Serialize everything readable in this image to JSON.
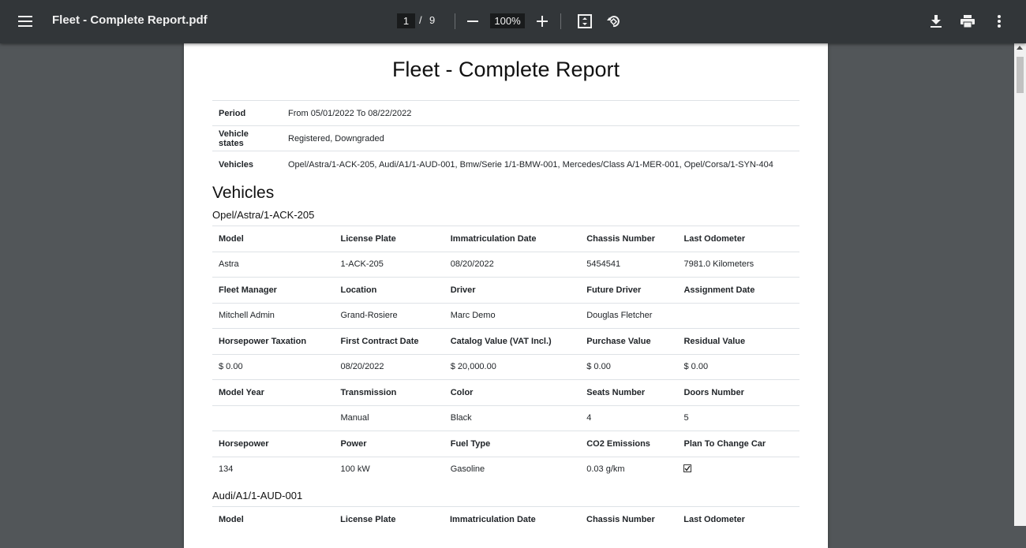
{
  "toolbar": {
    "title": "Fleet - Complete Report.pdf",
    "page_current": "1",
    "page_sep": "/",
    "page_total": "9",
    "zoom": "100%"
  },
  "report": {
    "title": "Fleet - Complete Report",
    "info": [
      {
        "key": "Period",
        "value": "From 05/01/2022 To 08/22/2022"
      },
      {
        "key": "Vehicle states",
        "value": "Registered, Downgraded"
      },
      {
        "key": "Vehicles",
        "value": "Opel/Astra/1-ACK-205, Audi/A1/1-AUD-001, Bmw/Serie 1/1-BMW-001, Mercedes/Class A/1-MER-001, Opel/Corsa/1-SYN-404"
      }
    ],
    "section_title": "Vehicles",
    "vehicles": [
      {
        "name": "Opel/Astra/1-ACK-205",
        "rows": [
          {
            "h": [
              "Model",
              "License Plate",
              "Immatriculation Date",
              "Chassis Number",
              "Last Odometer"
            ],
            "v": [
              "Astra",
              "1-ACK-205",
              "08/20/2022",
              "5454541",
              "7981.0 Kilometers"
            ]
          },
          {
            "h": [
              "Fleet Manager",
              "Location",
              "Driver",
              "Future Driver",
              "Assignment Date"
            ],
            "v": [
              "Mitchell Admin",
              "Grand-Rosiere",
              "Marc Demo",
              "Douglas Fletcher",
              ""
            ]
          },
          {
            "h": [
              "Horsepower Taxation",
              "First Contract Date",
              "Catalog Value (VAT Incl.)",
              "Purchase Value",
              "Residual Value"
            ],
            "v": [
              "$ 0.00",
              "08/20/2022",
              "$ 20,000.00",
              "$ 0.00",
              "$ 0.00"
            ]
          },
          {
            "h": [
              "Model Year",
              "Transmission",
              "Color",
              "Seats Number",
              "Doors Number"
            ],
            "v": [
              "",
              "Manual",
              "Black",
              "4",
              "5"
            ]
          },
          {
            "h": [
              "Horsepower",
              "Power",
              "Fuel Type",
              "CO2 Emissions",
              "Plan To Change Car"
            ],
            "v": [
              "134",
              "100 kW",
              "Gasoline",
              "0.03 g/km",
              ""
            ]
          }
        ],
        "plan_to_change_car": true
      },
      {
        "name": "Audi/A1/1-AUD-001",
        "rows": [
          {
            "h": [
              "Model",
              "License Plate",
              "Immatriculation Date",
              "Chassis Number",
              "Last Odometer"
            ]
          }
        ]
      }
    ]
  }
}
